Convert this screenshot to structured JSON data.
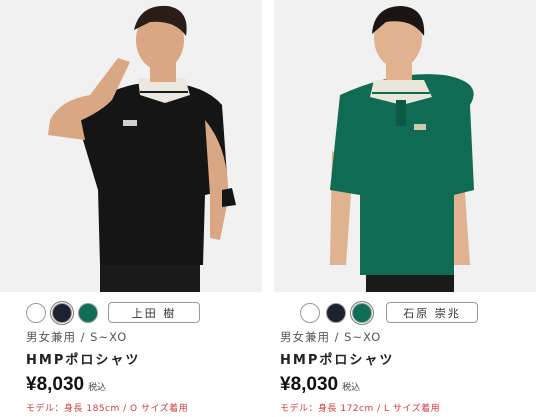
{
  "products": [
    {
      "id_label": "left",
      "colors": [
        "#ffffff",
        "#1c2230",
        "#0e6e57"
      ],
      "selected_color": 1,
      "model_name": "上田 樹",
      "category": "男女兼用 / S~XO",
      "title": "HMPポロシャツ",
      "price": "¥8,030",
      "tax_label": "税込",
      "model_info": "モデル：身長 185cm / O サイズ着用"
    },
    {
      "id_label": "right",
      "colors": [
        "#ffffff",
        "#1c2230",
        "#0e6e57"
      ],
      "selected_color": 2,
      "model_name": "石原 崇兆",
      "category": "男女兼用 / S~XO",
      "title": "HMPポロシャツ",
      "price": "¥8,030",
      "tax_label": "税込",
      "model_info": "モデル：身長 172cm / L サイズ着用"
    }
  ]
}
